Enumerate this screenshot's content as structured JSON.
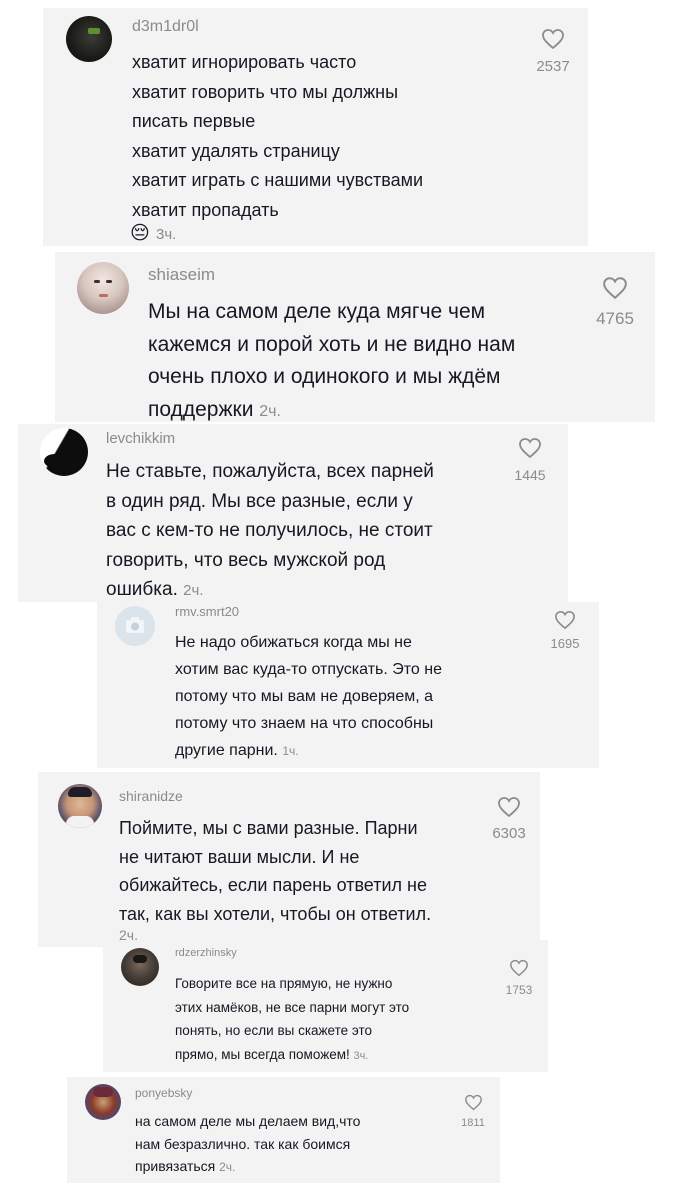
{
  "comments": [
    {
      "username": "d3m1dr0l",
      "lines": [
        "хватит игнорировать часто",
        "хватит говорить что мы должны",
        "писать первые",
        "хватит удалять страницу",
        "хватит играть с нашими чувствами",
        "хватит пропадать"
      ],
      "emoji": "😔",
      "time": "3ч.",
      "likes": "2537",
      "avatar_icon": "dark-silhouette-avatar"
    },
    {
      "username": "shiaseim",
      "lines": [
        "Мы на самом деле куда мягче чем",
        "кажемся и порой хоть и не видно нам",
        "очень плохо и одинокого и мы ждём",
        "поддержки"
      ],
      "time": "2ч.",
      "likes": "4765",
      "avatar_icon": "girl-portrait-avatar"
    },
    {
      "username": "levchikkim",
      "lines": [
        "Не ставьте, пожалуйста, всех парней",
        "в один ряд. Мы все разные, если у",
        "вас с кем-то не получилось, не стоит",
        "говорить, что весь мужской род",
        "ошибка."
      ],
      "time": "2ч.",
      "likes": "1445",
      "avatar_icon": "black-white-avatar"
    },
    {
      "username": "rmv.smrt20",
      "lines": [
        "Не надо обижаться когда мы не",
        "хотим вас куда-то отпускать. Это не",
        "потому что мы вам не доверяем, а",
        "потому что знаем на что способны",
        "другие парни."
      ],
      "time": "1ч.",
      "likes": "1695",
      "avatar_icon": "camera-placeholder-icon"
    },
    {
      "username": "shiranidze",
      "lines": [
        "Поймите, мы с вами разные. Парни",
        "не читают ваши мысли. И не",
        "обижайтесь, если парень ответил не",
        "так, как вы хотели, чтобы он ответил."
      ],
      "time": "2ч.",
      "likes": "6303",
      "avatar_icon": "man-portrait-avatar"
    },
    {
      "username": "rdzerzhinsky",
      "lines": [
        "Говорите все на прямую, не нужно",
        "этих намёков, не все парни могут это",
        "понять, но если вы скажете это",
        "прямо, мы всегда поможем!"
      ],
      "time": "3ч.",
      "likes": "1753",
      "avatar_icon": "dark-portrait-avatar"
    },
    {
      "username": "ponyebsky",
      "lines": [
        "на самом деле мы делаем вид,что",
        "нам безразлично. так как боимся",
        "привязаться"
      ],
      "time": "2ч.",
      "likes": "1811",
      "avatar_icon": "colorful-portrait-avatar"
    }
  ]
}
